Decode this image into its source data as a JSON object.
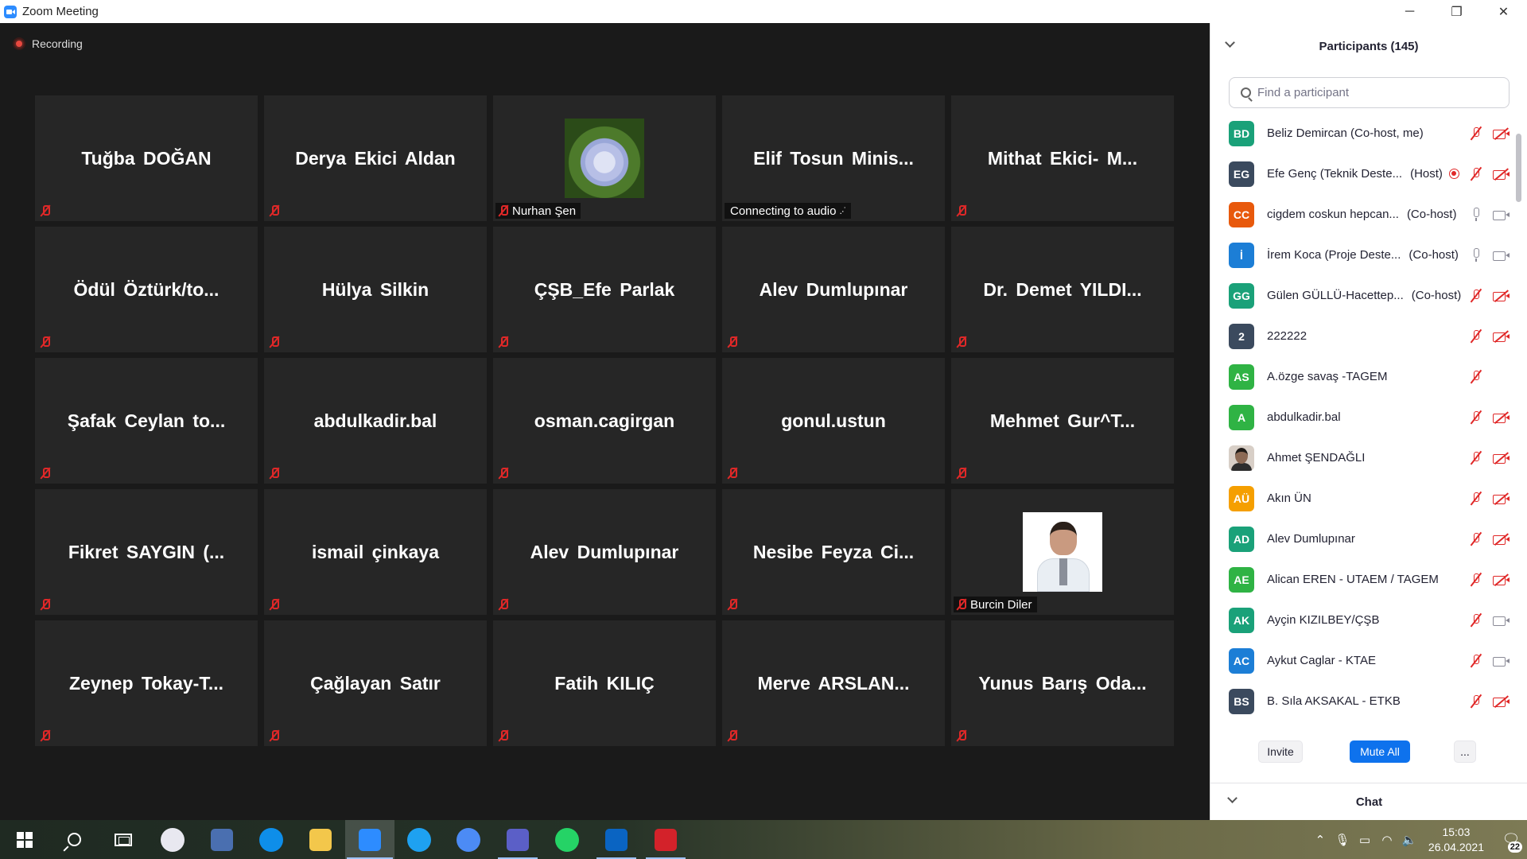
{
  "window": {
    "title": "Zoom Meeting",
    "minimize": "─",
    "restore": "❐",
    "close": "✕"
  },
  "recording": {
    "label": "Recording"
  },
  "tiles": [
    {
      "name": "Tuğba DOĞAN"
    },
    {
      "name": "Derya Ekici Aldan"
    },
    {
      "name": "",
      "footer_label": "Nurhan Şen",
      "picture": "hydrangea-flower-image"
    },
    {
      "name": "Elif Tosun Minis...",
      "footer_label": "Connecting to audio",
      "connecting": true
    },
    {
      "name": "Mithat Ekici- M..."
    },
    {
      "name": "Ödül Öztürk/to..."
    },
    {
      "name": "Hülya Silkin"
    },
    {
      "name": "ÇŞB_Efe Parlak"
    },
    {
      "name": "Alev Dumlupınar"
    },
    {
      "name": "Dr. Demet YILDI..."
    },
    {
      "name": "Şafak Ceylan to..."
    },
    {
      "name": "abdulkadir.bal"
    },
    {
      "name": "osman.cagirgan"
    },
    {
      "name": "gonul.ustun"
    },
    {
      "name": "Mehmet Gur^T..."
    },
    {
      "name": "Fikret SAYGIN (..."
    },
    {
      "name": "ismail çinkaya"
    },
    {
      "name": "Alev Dumlupınar"
    },
    {
      "name": "Nesibe Feyza Ci..."
    },
    {
      "name": "",
      "footer_label": "Burcin Diler",
      "picture": "profile-photo"
    },
    {
      "name": "Zeynep Tokay-T..."
    },
    {
      "name": "Çağlayan Satır"
    },
    {
      "name": "Fatih KILIÇ"
    },
    {
      "name": "Merve ARSLAN..."
    },
    {
      "name": "Yunus Barış Oda..."
    }
  ],
  "participants": {
    "title": "Participants (145)",
    "search_placeholder": "Find a participant",
    "list": [
      {
        "initials": "BD",
        "color": "#1aa179",
        "name": "Beliz Demircan (Co-host, me)",
        "role": "",
        "mic": "off",
        "cam": "off"
      },
      {
        "initials": "EG",
        "color": "#3b4a5e",
        "name": "Efe Genç (Teknik Deste...",
        "role": "(Host)",
        "mic": "off",
        "cam": "off",
        "recording": true
      },
      {
        "initials": "CC",
        "color": "#e8590c",
        "name": "cigdem coskun hepcan...",
        "role": "(Co-host)",
        "mic": "on",
        "cam": "on"
      },
      {
        "initials": "İ",
        "color": "#1c7ed6",
        "name": "İrem Koca (Proje Deste...",
        "role": "(Co-host)",
        "mic": "on",
        "cam": "on"
      },
      {
        "initials": "GG",
        "color": "#1aa179",
        "name": "Gülen GÜLLÜ-Hacettep...",
        "role": "(Co-host)",
        "mic": "off",
        "cam": "off"
      },
      {
        "initials": "2",
        "color": "#3b4a5e",
        "name": "222222",
        "role": "",
        "mic": "off",
        "cam": "off"
      },
      {
        "initials": "AS",
        "color": "#2fb344",
        "name": "A.özge savaş -TAGEM",
        "role": "",
        "mic": "off",
        "cam": "none"
      },
      {
        "initials": "A",
        "color": "#2fb344",
        "name": "abdulkadir.bal",
        "role": "",
        "mic": "off",
        "cam": "off"
      },
      {
        "initials": "",
        "color": "#d8cfc7",
        "name": "Ahmet ŞENDAĞLI",
        "role": "",
        "mic": "off",
        "cam": "off",
        "photo": true
      },
      {
        "initials": "AÜ",
        "color": "#f59f00",
        "name": "Akın ÜN",
        "role": "",
        "mic": "off",
        "cam": "off"
      },
      {
        "initials": "AD",
        "color": "#1aa179",
        "name": "Alev Dumlupınar",
        "role": "",
        "mic": "off",
        "cam": "off"
      },
      {
        "initials": "AE",
        "color": "#2fb344",
        "name": "Alican EREN - UTAEM / TAGEM",
        "role": "",
        "mic": "off",
        "cam": "off"
      },
      {
        "initials": "AK",
        "color": "#1aa179",
        "name": "Ayçin KIZILBEY/ÇŞB",
        "role": "",
        "mic": "off",
        "cam": "on"
      },
      {
        "initials": "AC",
        "color": "#1c7ed6",
        "name": "Aykut Caglar - KTAE",
        "role": "",
        "mic": "off",
        "cam": "on"
      },
      {
        "initials": "BS",
        "color": "#3b4a5e",
        "name": "B. Sıla AKSAKAL - ETKB",
        "role": "",
        "mic": "off",
        "cam": "off"
      }
    ],
    "invite_label": "Invite",
    "mute_all_label": "Mute All",
    "more_label": "...",
    "chat_title": "Chat"
  },
  "taskbar": {
    "apps": [
      {
        "name": "start-button",
        "kind": "start"
      },
      {
        "name": "search-button",
        "kind": "search"
      },
      {
        "name": "task-view-button",
        "kind": "task"
      },
      {
        "name": "paint-app",
        "kind": "round",
        "color": "#e8e8f0"
      },
      {
        "name": "calculator-app",
        "kind": "sq",
        "color": "#4a6fb0"
      },
      {
        "name": "teamviewer-app",
        "kind": "round",
        "color": "#0e8ee9"
      },
      {
        "name": "file-explorer-app",
        "kind": "sq",
        "color": "#f3c74b"
      },
      {
        "name": "zoom-app",
        "kind": "sq",
        "color": "#2d8cff",
        "active": true
      },
      {
        "name": "internet-explorer-app",
        "kind": "round",
        "color": "#1ea1f1"
      },
      {
        "name": "chrome-app",
        "kind": "round",
        "color": "#4c8bf5"
      },
      {
        "name": "teams-app",
        "kind": "sq",
        "color": "#5b5fc7",
        "running": true
      },
      {
        "name": "whatsapp-app",
        "kind": "round",
        "color": "#25d366"
      },
      {
        "name": "outlook-app",
        "kind": "sq",
        "color": "#0a64c2",
        "running": true
      },
      {
        "name": "acrobat-app",
        "kind": "sq",
        "color": "#d3222a",
        "running": true
      }
    ],
    "time": "15:03",
    "date": "26.04.2021",
    "notification_count": "22"
  }
}
